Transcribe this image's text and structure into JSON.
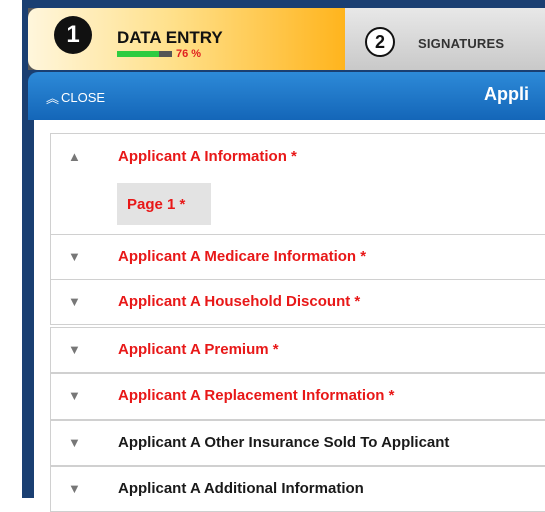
{
  "steps": {
    "step1": {
      "number": "1",
      "label": "DATA ENTRY",
      "progress_text": "76 %",
      "progress": 0.76
    },
    "step2": {
      "number": "2",
      "label": "SIGNATURES"
    }
  },
  "panel": {
    "close_label": "CLOSE",
    "close_icon": "double-chevron-up-icon",
    "title": "Appli"
  },
  "sections": [
    {
      "title": "Applicant A Information *",
      "required": true,
      "expanded": true,
      "pages": [
        {
          "label": "Page 1 *"
        }
      ]
    },
    {
      "title": "Applicant A Medicare Information *",
      "required": true,
      "expanded": false
    },
    {
      "title": "Applicant A Household Discount *",
      "required": true,
      "expanded": false
    },
    {
      "title": "Applicant A Premium *",
      "required": true,
      "expanded": false
    },
    {
      "title": "Applicant A Replacement Information *",
      "required": true,
      "expanded": false
    },
    {
      "title": "Applicant A Other Insurance Sold To Applicant",
      "required": false,
      "expanded": false
    },
    {
      "title": "Applicant A Additional Information",
      "required": false,
      "expanded": false
    }
  ],
  "colors": {
    "required_text": "#e81818",
    "normal_text": "#1a1a1a",
    "header_blue": "#1f78c8",
    "progress_green": "#2ecc40",
    "active_step": "#ffb31a"
  }
}
